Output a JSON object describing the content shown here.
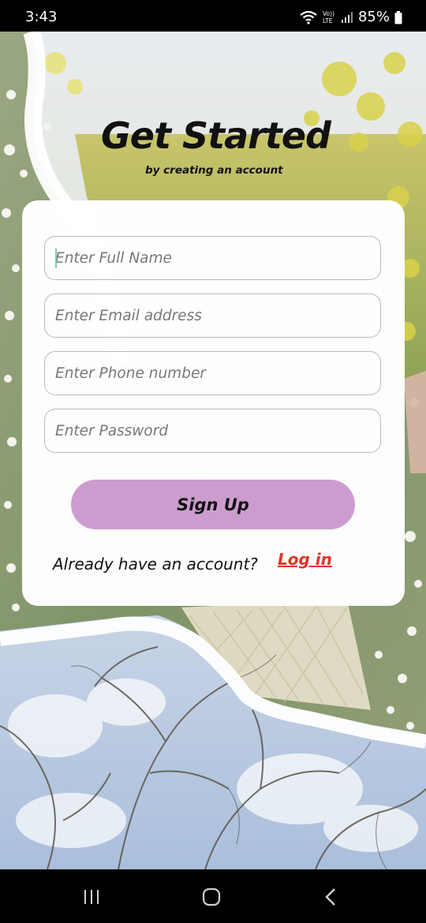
{
  "status_bar": {
    "time": "3:43",
    "network": "VoLTE",
    "battery": "85%"
  },
  "header": {
    "title": "Get Started",
    "subtitle": "by creating an account"
  },
  "form": {
    "full_name": {
      "placeholder": "Enter Full Name",
      "value": ""
    },
    "email": {
      "placeholder": "Enter Email address",
      "value": ""
    },
    "phone": {
      "placeholder": "Enter Phone number",
      "value": ""
    },
    "password": {
      "placeholder": "Enter Password",
      "value": ""
    },
    "signup_label": "Sign Up",
    "login_prompt": "Already have an account?",
    "login_link": "Log in"
  },
  "colors": {
    "signup_button": "#cc9ccf",
    "login_link": "#e0342a",
    "field_border": "#b9b9b9"
  },
  "nav_bar": {
    "icons": [
      "recents-icon",
      "home-icon",
      "back-icon"
    ]
  }
}
